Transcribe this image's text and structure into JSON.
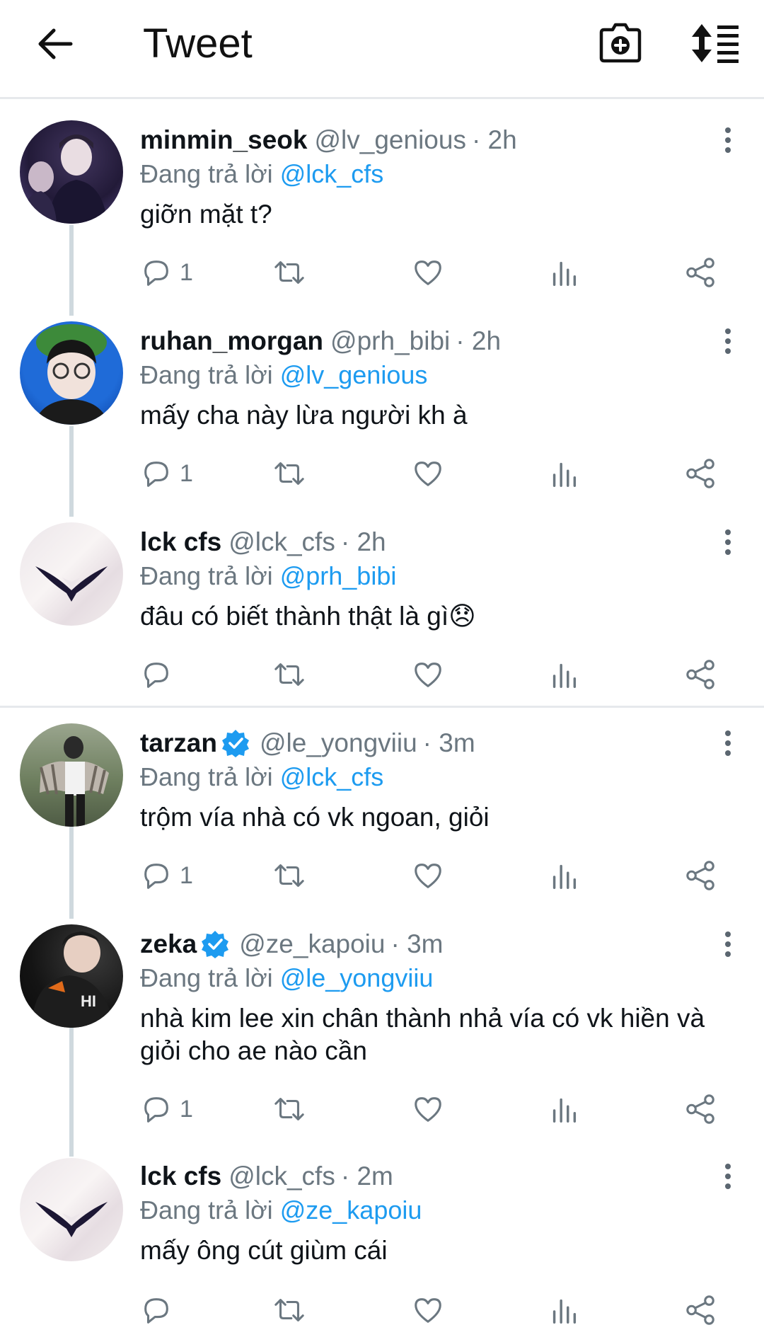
{
  "header": {
    "back_icon": "arrow-left-icon",
    "title": "Tweet",
    "camera_icon": "camera-plus-icon",
    "sort_icon": "sort-list-icon"
  },
  "colors": {
    "link": "#1d9bf0",
    "muted": "#6b7780",
    "thread": "#cfd9de",
    "verified": "#1d9bf0"
  },
  "tweets": [
    {
      "name": "minmin_seok",
      "verified": false,
      "handle": "@lv_genious",
      "time": "· 2h",
      "replying_prefix": "Đang trả lời",
      "replying_to": "@lck_cfs",
      "text": "giỡn mặt t?",
      "reply_count": "1"
    },
    {
      "name": "ruhan_morgan",
      "verified": false,
      "handle": "@prh_bibi",
      "time": "· 2h",
      "replying_prefix": "Đang trả lời",
      "replying_to": "@lv_genious",
      "text": "mấy cha này lừa người kh à",
      "reply_count": "1"
    },
    {
      "name": "lck cfs",
      "verified": false,
      "handle": "@lck_cfs",
      "time": "· 2h",
      "replying_prefix": "Đang trả lời",
      "replying_to": "@prh_bibi",
      "text": "đâu có biết thành thật là gì😞",
      "reply_count": ""
    },
    {
      "name": "tarzan",
      "verified": true,
      "handle": "@le_yongviiu",
      "time": "· 3m",
      "replying_prefix": "Đang trả lời",
      "replying_to": "@lck_cfs",
      "text": "trộm vía nhà có vk ngoan, giỏi",
      "reply_count": "1"
    },
    {
      "name": "zeka",
      "verified": true,
      "handle": "@ze_kapoiu",
      "time": "· 3m",
      "replying_prefix": "Đang trả lời",
      "replying_to": "@le_yongviiu",
      "text": "nhà kim lee xin chân thành nhả vía có vk hiền và giỏi cho ae nào cần",
      "reply_count": "1"
    },
    {
      "name": "lck cfs",
      "verified": false,
      "handle": "@lck_cfs",
      "time": "· 2m",
      "replying_prefix": "Đang trả lời",
      "replying_to": "@ze_kapoiu",
      "text": "mấy ông cút giùm cái",
      "reply_count": ""
    }
  ]
}
